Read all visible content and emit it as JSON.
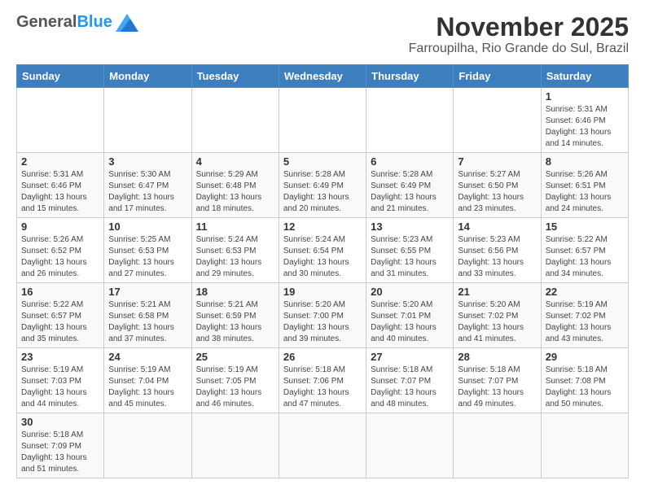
{
  "header": {
    "logo_general": "General",
    "logo_blue": "Blue",
    "month_title": "November 2025",
    "subtitle": "Farroupilha, Rio Grande do Sul, Brazil"
  },
  "days_of_week": [
    "Sunday",
    "Monday",
    "Tuesday",
    "Wednesday",
    "Thursday",
    "Friday",
    "Saturday"
  ],
  "weeks": [
    [
      {
        "day": "",
        "info": ""
      },
      {
        "day": "",
        "info": ""
      },
      {
        "day": "",
        "info": ""
      },
      {
        "day": "",
        "info": ""
      },
      {
        "day": "",
        "info": ""
      },
      {
        "day": "",
        "info": ""
      },
      {
        "day": "1",
        "info": "Sunrise: 5:31 AM\nSunset: 6:46 PM\nDaylight: 13 hours\nand 14 minutes."
      }
    ],
    [
      {
        "day": "2",
        "info": "Sunrise: 5:31 AM\nSunset: 6:46 PM\nDaylight: 13 hours\nand 15 minutes."
      },
      {
        "day": "3",
        "info": "Sunrise: 5:30 AM\nSunset: 6:47 PM\nDaylight: 13 hours\nand 17 minutes."
      },
      {
        "day": "4",
        "info": "Sunrise: 5:29 AM\nSunset: 6:48 PM\nDaylight: 13 hours\nand 18 minutes."
      },
      {
        "day": "5",
        "info": "Sunrise: 5:28 AM\nSunset: 6:49 PM\nDaylight: 13 hours\nand 20 minutes."
      },
      {
        "day": "6",
        "info": "Sunrise: 5:28 AM\nSunset: 6:49 PM\nDaylight: 13 hours\nand 21 minutes."
      },
      {
        "day": "7",
        "info": "Sunrise: 5:27 AM\nSunset: 6:50 PM\nDaylight: 13 hours\nand 23 minutes."
      },
      {
        "day": "8",
        "info": "Sunrise: 5:26 AM\nSunset: 6:51 PM\nDaylight: 13 hours\nand 24 minutes."
      }
    ],
    [
      {
        "day": "9",
        "info": "Sunrise: 5:26 AM\nSunset: 6:52 PM\nDaylight: 13 hours\nand 26 minutes."
      },
      {
        "day": "10",
        "info": "Sunrise: 5:25 AM\nSunset: 6:53 PM\nDaylight: 13 hours\nand 27 minutes."
      },
      {
        "day": "11",
        "info": "Sunrise: 5:24 AM\nSunset: 6:53 PM\nDaylight: 13 hours\nand 29 minutes."
      },
      {
        "day": "12",
        "info": "Sunrise: 5:24 AM\nSunset: 6:54 PM\nDaylight: 13 hours\nand 30 minutes."
      },
      {
        "day": "13",
        "info": "Sunrise: 5:23 AM\nSunset: 6:55 PM\nDaylight: 13 hours\nand 31 minutes."
      },
      {
        "day": "14",
        "info": "Sunrise: 5:23 AM\nSunset: 6:56 PM\nDaylight: 13 hours\nand 33 minutes."
      },
      {
        "day": "15",
        "info": "Sunrise: 5:22 AM\nSunset: 6:57 PM\nDaylight: 13 hours\nand 34 minutes."
      }
    ],
    [
      {
        "day": "16",
        "info": "Sunrise: 5:22 AM\nSunset: 6:57 PM\nDaylight: 13 hours\nand 35 minutes."
      },
      {
        "day": "17",
        "info": "Sunrise: 5:21 AM\nSunset: 6:58 PM\nDaylight: 13 hours\nand 37 minutes."
      },
      {
        "day": "18",
        "info": "Sunrise: 5:21 AM\nSunset: 6:59 PM\nDaylight: 13 hours\nand 38 minutes."
      },
      {
        "day": "19",
        "info": "Sunrise: 5:20 AM\nSunset: 7:00 PM\nDaylight: 13 hours\nand 39 minutes."
      },
      {
        "day": "20",
        "info": "Sunrise: 5:20 AM\nSunset: 7:01 PM\nDaylight: 13 hours\nand 40 minutes."
      },
      {
        "day": "21",
        "info": "Sunrise: 5:20 AM\nSunset: 7:02 PM\nDaylight: 13 hours\nand 41 minutes."
      },
      {
        "day": "22",
        "info": "Sunrise: 5:19 AM\nSunset: 7:02 PM\nDaylight: 13 hours\nand 43 minutes."
      }
    ],
    [
      {
        "day": "23",
        "info": "Sunrise: 5:19 AM\nSunset: 7:03 PM\nDaylight: 13 hours\nand 44 minutes."
      },
      {
        "day": "24",
        "info": "Sunrise: 5:19 AM\nSunset: 7:04 PM\nDaylight: 13 hours\nand 45 minutes."
      },
      {
        "day": "25",
        "info": "Sunrise: 5:19 AM\nSunset: 7:05 PM\nDaylight: 13 hours\nand 46 minutes."
      },
      {
        "day": "26",
        "info": "Sunrise: 5:18 AM\nSunset: 7:06 PM\nDaylight: 13 hours\nand 47 minutes."
      },
      {
        "day": "27",
        "info": "Sunrise: 5:18 AM\nSunset: 7:07 PM\nDaylight: 13 hours\nand 48 minutes."
      },
      {
        "day": "28",
        "info": "Sunrise: 5:18 AM\nSunset: 7:07 PM\nDaylight: 13 hours\nand 49 minutes."
      },
      {
        "day": "29",
        "info": "Sunrise: 5:18 AM\nSunset: 7:08 PM\nDaylight: 13 hours\nand 50 minutes."
      }
    ],
    [
      {
        "day": "30",
        "info": "Sunrise: 5:18 AM\nSunset: 7:09 PM\nDaylight: 13 hours\nand 51 minutes."
      },
      {
        "day": "",
        "info": ""
      },
      {
        "day": "",
        "info": ""
      },
      {
        "day": "",
        "info": ""
      },
      {
        "day": "",
        "info": ""
      },
      {
        "day": "",
        "info": ""
      },
      {
        "day": "",
        "info": ""
      }
    ]
  ]
}
